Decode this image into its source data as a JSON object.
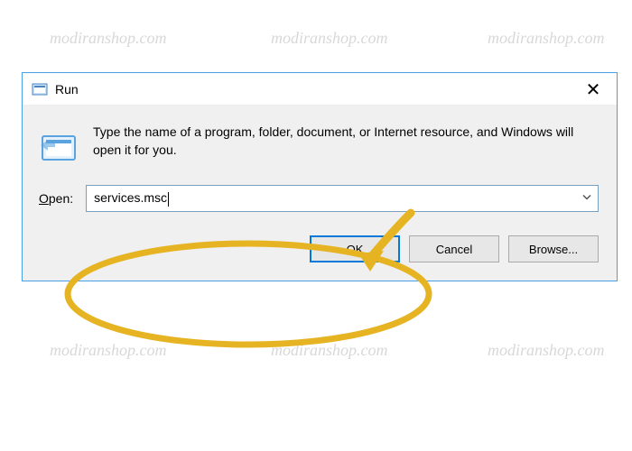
{
  "watermark": "modiranshop.com",
  "dialog": {
    "title": "Run",
    "close": "✕",
    "description": "Type the name of a program, folder, document, or Internet resource, and Windows will open it for you.",
    "open_label_u": "O",
    "open_label_rest": "pen:",
    "input_value": "services.msc",
    "buttons": {
      "ok": "OK",
      "cancel": "Cancel",
      "browse": "Browse..."
    }
  }
}
